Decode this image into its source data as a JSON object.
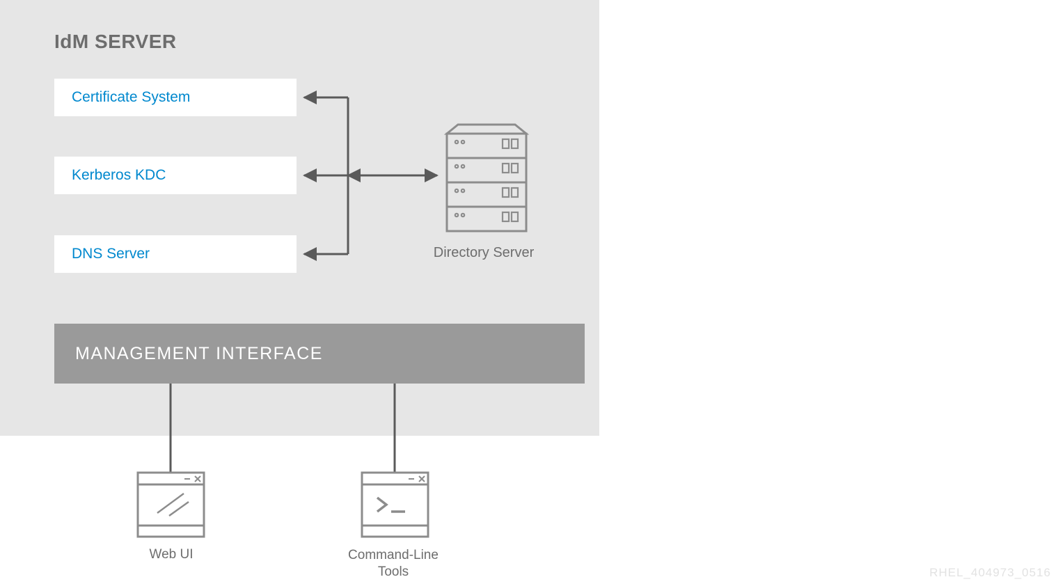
{
  "server_title": "IdM SERVER",
  "services": {
    "certificate": "Certificate System",
    "kerberos": "Kerberos KDC",
    "dns": "DNS Server"
  },
  "directory_server_label": "Directory Server",
  "management_label": "MANAGEMENT INTERFACE",
  "interfaces": {
    "web_ui": "Web UI",
    "cli": "Command-Line Tools"
  },
  "footer_code": "RHEL_404973_0516",
  "colors": {
    "bg_grey": "#e6e6e6",
    "accent_blue": "#0088ce",
    "mgmt_grey": "#9a9a9a",
    "line_grey": "#5a5a5a",
    "icon_grey": "#8c8c8c"
  }
}
